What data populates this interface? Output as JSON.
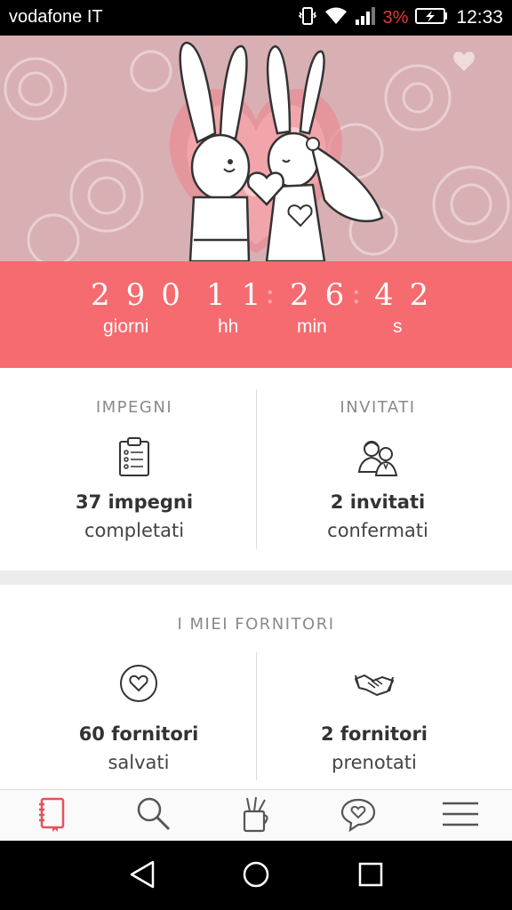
{
  "status_bar": {
    "carrier": "vodafone IT",
    "battery_percent": "3%",
    "time": "12:33",
    "icons": [
      "vibrate-icon",
      "wifi-icon",
      "signal-icon",
      "battery-charging-icon"
    ]
  },
  "countdown": {
    "days": "290",
    "hours": "11",
    "minutes": "26",
    "seconds": "42",
    "days_label": "giorni",
    "hours_label": "hh",
    "minutes_label": "min",
    "seconds_label": "s"
  },
  "tasks": {
    "title": "IMPEGNI",
    "count_text": "37 impegni",
    "status_text": "completati",
    "icon": "clipboard-checklist-icon"
  },
  "guests": {
    "title": "INVITATI",
    "count_text": "2 invitati",
    "status_text": "confermati",
    "icon": "guests-couple-icon"
  },
  "vendors": {
    "title": "I MIEI FORNITORI",
    "saved": {
      "count_text": "60 fornitori",
      "status_text": "salvati",
      "icon": "heart-circle-icon"
    },
    "booked": {
      "count_text": "2 fornitori",
      "status_text": "prenotati",
      "icon": "handshake-icon"
    }
  },
  "bottom_nav": {
    "items": [
      {
        "name": "notebook",
        "icon": "notebook-icon",
        "active": true
      },
      {
        "name": "search",
        "icon": "search-icon",
        "active": false
      },
      {
        "name": "tools",
        "icon": "pen-cup-icon",
        "active": false
      },
      {
        "name": "chat",
        "icon": "heart-chat-icon",
        "active": false
      },
      {
        "name": "menu",
        "icon": "hamburger-menu-icon",
        "active": false
      }
    ]
  },
  "colors": {
    "accent": "#f56b70",
    "active_nav": "#e8505b",
    "hero_background": "#d9b2b6"
  }
}
